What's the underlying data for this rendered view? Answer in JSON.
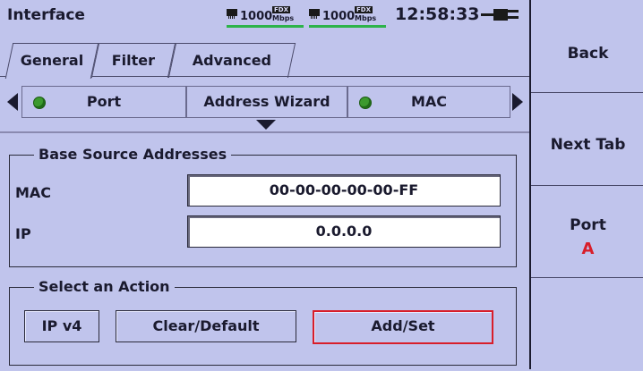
{
  "header": {
    "title": "Interface",
    "links": [
      {
        "speed": "1000",
        "duplex": "FDX",
        "unit": "Mbps"
      },
      {
        "speed": "1000",
        "duplex": "FDX",
        "unit": "Mbps"
      }
    ],
    "time": "12:58:33"
  },
  "tabs": [
    {
      "label": "General",
      "active": true
    },
    {
      "label": "Filter",
      "active": false
    },
    {
      "label": "Advanced",
      "active": false
    }
  ],
  "subnav": {
    "items": [
      {
        "label": "Port",
        "led": "green"
      },
      {
        "label": "Address Wizard"
      },
      {
        "label": "MAC",
        "led": "green"
      }
    ]
  },
  "base_source": {
    "legend": "Base Source Addresses",
    "mac_label": "MAC",
    "mac_value": "00-00-00-00-00-FF",
    "ip_label": "IP",
    "ip_value": "0.0.0.0"
  },
  "actions": {
    "legend": "Select an Action",
    "buttons": [
      "IP v4",
      "Clear/Default",
      "Add/Set"
    ],
    "selected": "Add/Set"
  },
  "sidebar": {
    "back": "Back",
    "next_tab": "Next Tab",
    "port_label": "Port",
    "port_value": "A"
  },
  "colors": {
    "background": "#c0c4ec",
    "selected_border": "#d81e2a",
    "led_green": "#3c9a2e",
    "link_bar": "#2db34a",
    "port_value": "#d81e2a"
  },
  "icons": [
    "nic-icon",
    "power-plug-icon",
    "arrow-left-icon",
    "arrow-right-icon",
    "arrow-down-icon",
    "led-green-icon"
  ]
}
